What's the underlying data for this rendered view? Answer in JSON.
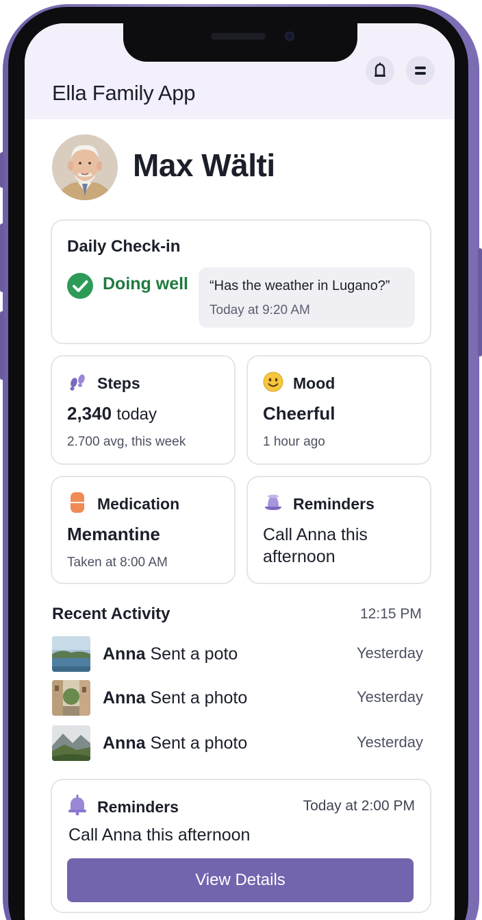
{
  "app": {
    "title": "Ella Family App"
  },
  "colors": {
    "accent": "#7463ad",
    "header_bg": "#f3f0fb",
    "status_green": "#1f7a3f",
    "check_green": "#2e9a58"
  },
  "header": {
    "icons": [
      "bell-icon",
      "menu-icon"
    ]
  },
  "profile": {
    "name": "Max Wälti"
  },
  "daily_checkin": {
    "title": "Daily Check-in",
    "status": "Doing well",
    "quote": "“Has the weather in Lugano?”",
    "quote_time": "Today at 9:20 AM"
  },
  "tiles": {
    "steps": {
      "title": "Steps",
      "value": "2,340",
      "unit": "today",
      "sub": "2.700 avg, this week"
    },
    "mood": {
      "title": "Mood",
      "value": "Cheerful",
      "sub": "1 hour ago"
    },
    "medication": {
      "title": "Medication",
      "value": "Memantine",
      "sub": "Taken at 8:00 AM"
    },
    "reminders": {
      "title": "Reminders",
      "text": "Call Anna this afternoon"
    }
  },
  "recent_activity": {
    "title": "Recent Activity",
    "time": "12:15 PM",
    "items": [
      {
        "who": "Anna",
        "action": "Sent a poto",
        "time": "Yesterday"
      },
      {
        "who": "Anna",
        "action": "Sent a photo",
        "time": "Yesterday"
      },
      {
        "who": "Anna",
        "action": "Sent a photo",
        "time": "Yesterday"
      }
    ]
  },
  "reminder_card": {
    "title": "Reminders",
    "time": "Today at 2:00 PM",
    "text": "Call Anna this afternoon",
    "button_label": "View Details"
  }
}
